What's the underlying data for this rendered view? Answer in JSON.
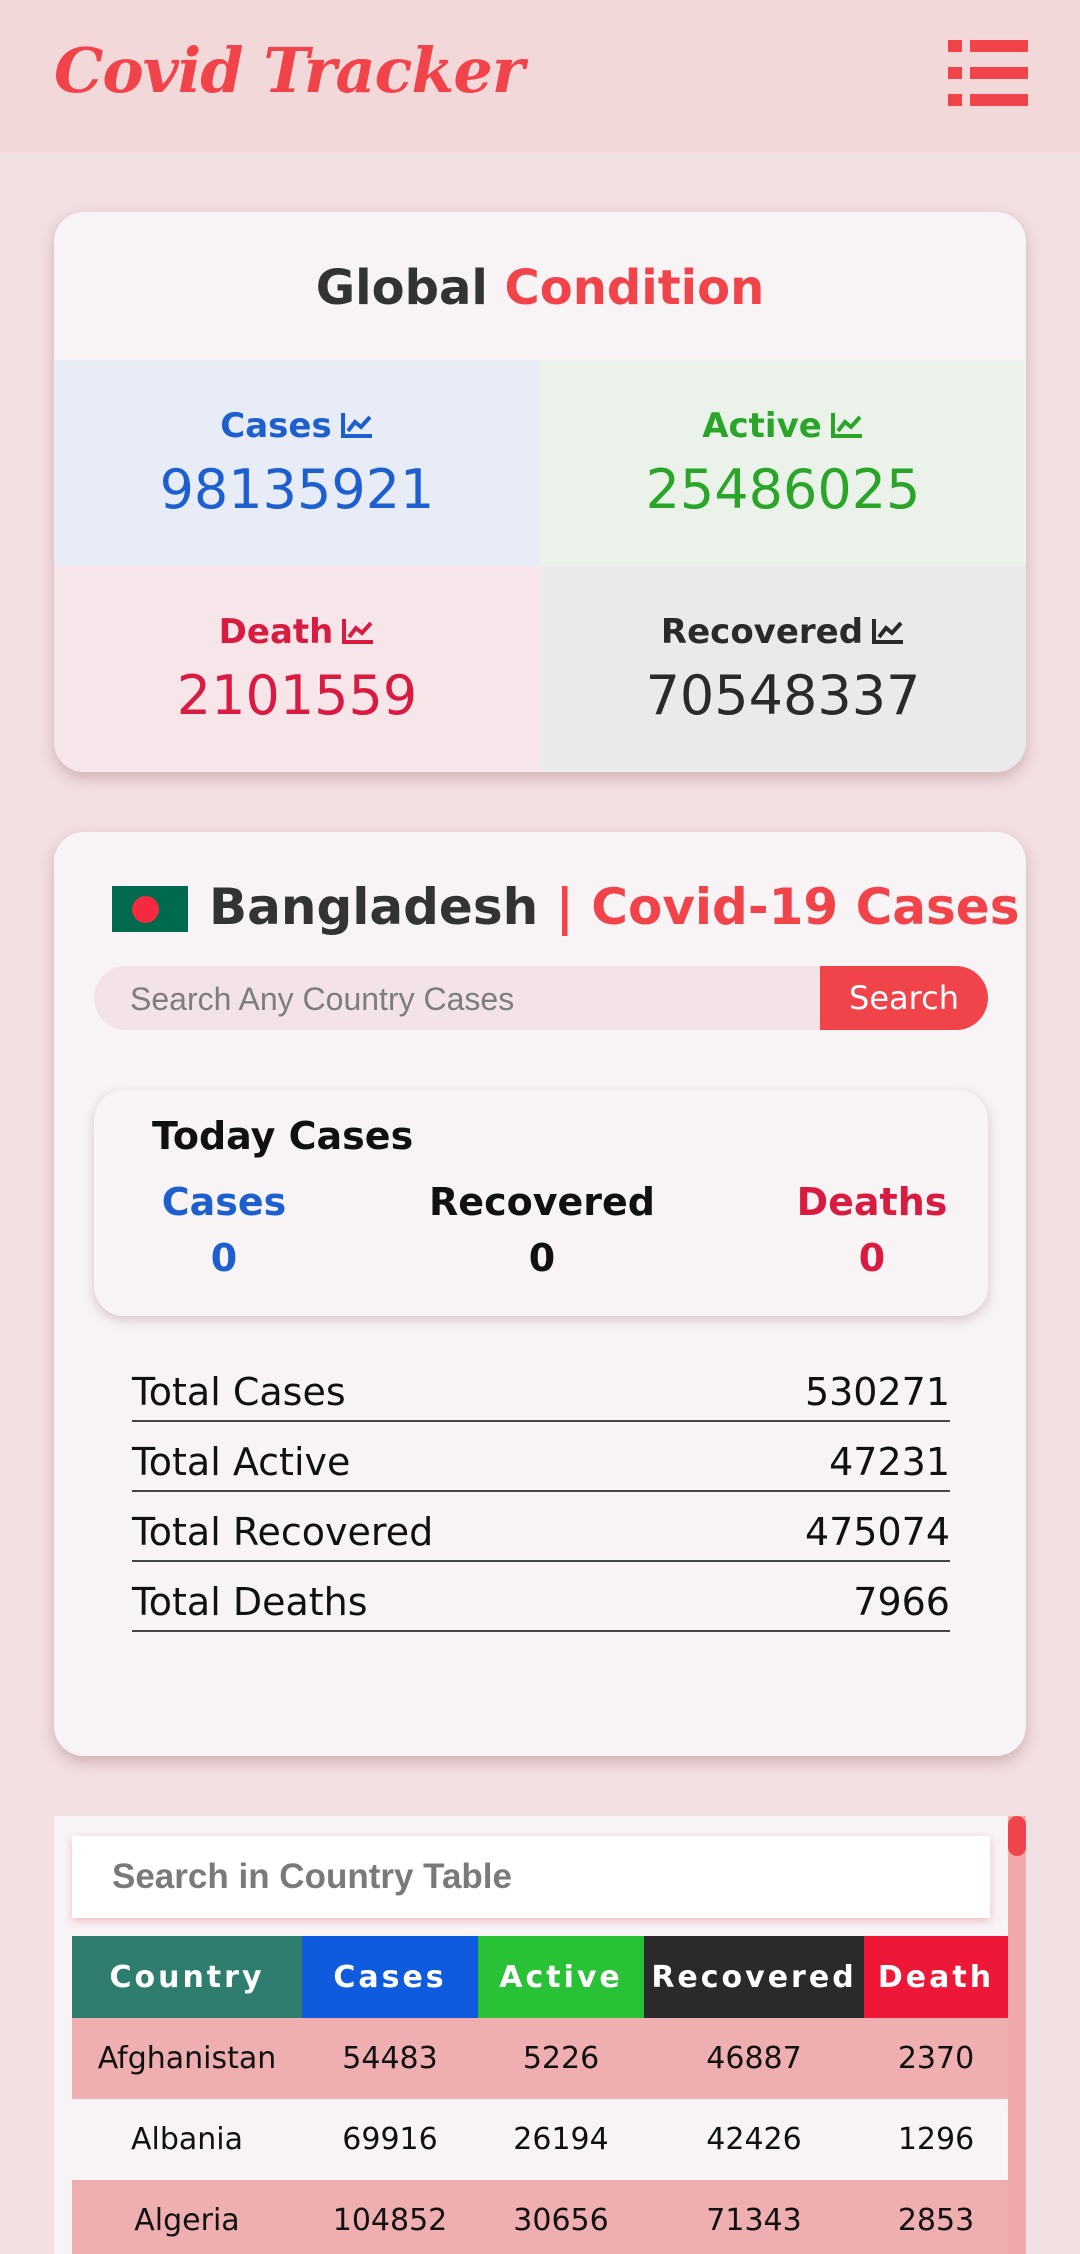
{
  "header": {
    "title": "Covid Tracker",
    "menu_icon": "hamburger-list-icon",
    "accent": "#f0444a"
  },
  "global": {
    "title_a": "Global",
    "title_b": "Condition",
    "cases": {
      "label": "Cases",
      "value": "98135921",
      "color": "#1e5fcf"
    },
    "active": {
      "label": "Active",
      "value": "25486025",
      "color": "#2aa52a"
    },
    "death": {
      "label": "Death",
      "value": "2101559",
      "color": "#d81b40"
    },
    "recovered": {
      "label": "Recovered",
      "value": "70548337",
      "color": "#2a2a2a"
    },
    "trend_icon": "chart-line-icon"
  },
  "country": {
    "name": "Bangladesh",
    "suffix": "| Covid-19 Cases",
    "flag_icon": "bangladesh-flag-icon",
    "search": {
      "placeholder": "Search Any Country Cases",
      "button": "Search"
    },
    "today": {
      "title": "Today Cases",
      "cases_label": "Cases",
      "cases_value": "0",
      "recovered_label": "Recovered",
      "recovered_value": "0",
      "deaths_label": "Deaths",
      "deaths_value": "0"
    },
    "totals": [
      {
        "label": "Total Cases",
        "value": "530271"
      },
      {
        "label": "Total Active",
        "value": "47231"
      },
      {
        "label": "Total Recovered",
        "value": "475074"
      },
      {
        "label": "Total Deaths",
        "value": "7966"
      }
    ]
  },
  "table": {
    "search_placeholder": "Search in Country Table",
    "headers": [
      {
        "label": "Country",
        "color": "#2e7d6e"
      },
      {
        "label": "Cases",
        "color": "#0f5bdd"
      },
      {
        "label": "Active",
        "color": "#29c135"
      },
      {
        "label": "Recovered",
        "color": "#2a2a2a"
      },
      {
        "label": "Death",
        "color": "#ee1738"
      }
    ],
    "rows": [
      [
        "Afghanistan",
        "54483",
        "5226",
        "46887",
        "2370"
      ],
      [
        "Albania",
        "69916",
        "26194",
        "42426",
        "1296"
      ],
      [
        "Algeria",
        "104852",
        "30656",
        "71343",
        "2853"
      ]
    ]
  }
}
